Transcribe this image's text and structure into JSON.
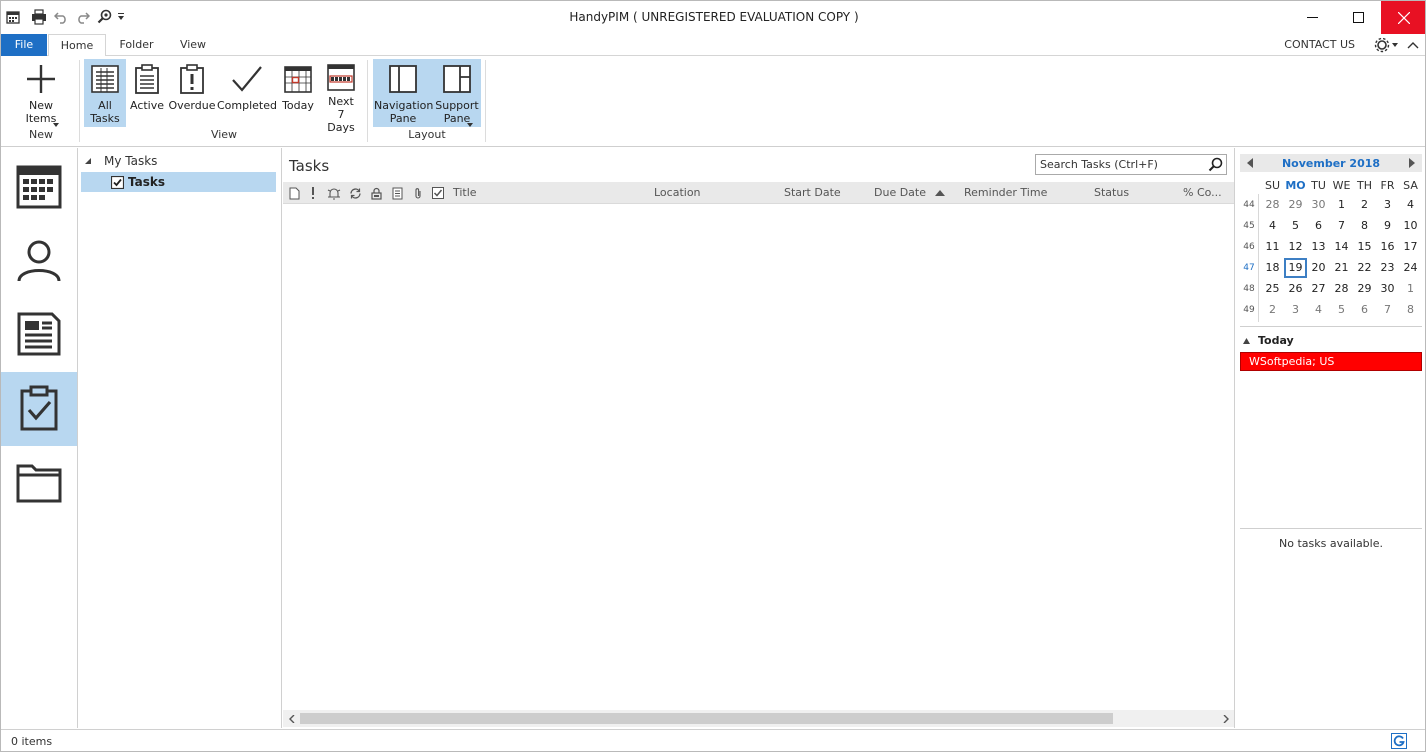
{
  "window": {
    "title": "HandyPIM ( UNREGISTERED EVALUATION COPY )"
  },
  "ribbon_tabs": {
    "file": "File",
    "home": "Home",
    "folder": "Folder",
    "view": "View",
    "contact_us": "CONTACT US"
  },
  "ribbon": {
    "new_items": "New Items",
    "group_new": "New",
    "all_tasks": "All Tasks",
    "active": "Active",
    "overdue": "Overdue",
    "completed": "Completed",
    "today": "Today",
    "next_7_days": "Next 7 Days",
    "group_view": "View",
    "navigation_pane": "Navigation Pane",
    "support_pane": "Support Pane",
    "group_layout": "Layout"
  },
  "folders": {
    "root": "My Tasks",
    "selected": "Tasks"
  },
  "main": {
    "title": "Tasks",
    "search_placeholder": "Search Tasks (Ctrl+F)",
    "columns": {
      "title": "Title",
      "location": "Location",
      "start_date": "Start Date",
      "due_date": "Due Date",
      "reminder_time": "Reminder Time",
      "status": "Status",
      "percent_complete": "% Co..."
    }
  },
  "calendar": {
    "month_title": "November 2018",
    "weekdays": [
      "SU",
      "MO",
      "TU",
      "WE",
      "TH",
      "FR",
      "SA"
    ],
    "today_weekday_index": 1,
    "weeks": [
      {
        "num": "44",
        "days": [
          "28",
          "29",
          "30",
          "1",
          "2",
          "3",
          "4"
        ]
      },
      {
        "num": "45",
        "days": [
          "4",
          "5",
          "6",
          "7",
          "8",
          "9",
          "10"
        ]
      },
      {
        "num": "46",
        "days": [
          "11",
          "12",
          "13",
          "14",
          "15",
          "16",
          "17"
        ]
      },
      {
        "num": "47",
        "days": [
          "18",
          "19",
          "20",
          "21",
          "22",
          "23",
          "24"
        ]
      },
      {
        "num": "48",
        "days": [
          "25",
          "26",
          "27",
          "28",
          "29",
          "30",
          "1"
        ]
      },
      {
        "num": "49",
        "days": [
          "2",
          "3",
          "4",
          "5",
          "6",
          "7",
          "8"
        ]
      }
    ],
    "current_week": "47",
    "today_day": "19"
  },
  "agenda": {
    "today_label": "Today",
    "appointment": "WSoftpedia; US",
    "appointment_color": "#ff0000"
  },
  "tasks_panel": {
    "empty_text": "No tasks available."
  },
  "status": {
    "items": "0 items"
  },
  "colors": {
    "accent": "#1e6fc5",
    "selection": "#b8d7f0",
    "close": "#e81123"
  }
}
